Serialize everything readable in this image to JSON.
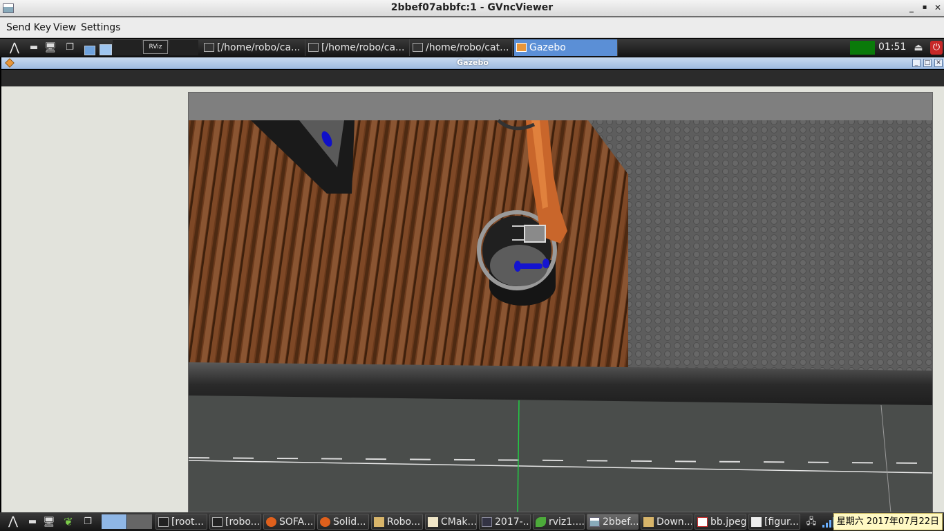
{
  "window": {
    "title": "2bbef07abbfc:1 - GVncViewer"
  },
  "menu": {
    "items": [
      "Send Key",
      "View",
      "Settings"
    ]
  },
  "top_panel": {
    "tasks": [
      "[/home/robo/ca...",
      "[/home/robo/ca...",
      "/home/robo/cat...",
      "Gazebo"
    ],
    "rviz_label": "RViz",
    "clock": "01:51"
  },
  "gazebo": {
    "title": "Gazebo"
  },
  "bottom_panel": {
    "tasks": [
      "[root...",
      "[robo...",
      "SOFA...",
      "Solid...",
      "Robo...",
      "CMak...",
      "2017-...",
      "rviz1....",
      "2bbef...",
      "Down...",
      "bb.jpeg",
      "[figur..."
    ],
    "clock": "星期六 2017年07月22日"
  },
  "colors": {
    "panel": "#1e1e1e",
    "active_task": "#5b8fd6",
    "gazebo_title": "#aac4e6"
  }
}
